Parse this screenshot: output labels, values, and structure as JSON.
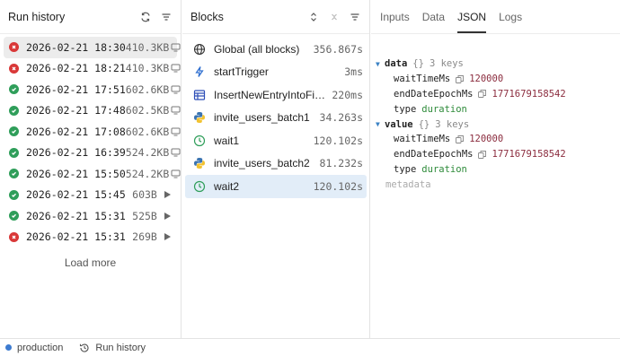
{
  "history": {
    "title": "Run history",
    "rows": [
      {
        "status": "error",
        "date": "2026-02-21 18:30",
        "size": "410.3KB",
        "action": "monitor-icon"
      },
      {
        "status": "error",
        "date": "2026-02-21 18:21",
        "size": "410.3KB",
        "action": "monitor-icon"
      },
      {
        "status": "success",
        "date": "2026-02-21 17:51",
        "size": "602.6KB",
        "action": "monitor-icon"
      },
      {
        "status": "success",
        "date": "2026-02-21 17:48",
        "size": "602.5KB",
        "action": "monitor-icon"
      },
      {
        "status": "success",
        "date": "2026-02-21 17:08",
        "size": "602.6KB",
        "action": "monitor-icon"
      },
      {
        "status": "success",
        "date": "2026-02-21 16:39",
        "size": "524.2KB",
        "action": "monitor-icon"
      },
      {
        "status": "success",
        "date": "2026-02-21 15:50",
        "size": "524.2KB",
        "action": "monitor-icon"
      },
      {
        "status": "success",
        "date": "2026-02-21 15:45",
        "size": "603B",
        "action": "play-icon"
      },
      {
        "status": "success",
        "date": "2026-02-21 15:31",
        "size": "525B",
        "action": "play-icon"
      },
      {
        "status": "error",
        "date": "2026-02-21 15:31",
        "size": "269B",
        "action": "play-icon"
      }
    ],
    "load_more": "Load more"
  },
  "blocks": {
    "title": "Blocks",
    "items": [
      {
        "icon": "globe-icon",
        "name": "Global (all blocks)",
        "time": "356.867s"
      },
      {
        "icon": "bolt-icon",
        "name": "startTrigger",
        "time": "3ms"
      },
      {
        "icon": "table-icon",
        "name": "InsertNewEntryIntoFiles...",
        "time": "220ms"
      },
      {
        "icon": "python-icon",
        "name": "invite_users_batch1",
        "time": "34.263s"
      },
      {
        "icon": "clock-icon",
        "name": "wait1",
        "time": "120.102s"
      },
      {
        "icon": "python-icon",
        "name": "invite_users_batch2",
        "time": "81.232s"
      },
      {
        "icon": "clock-icon",
        "name": "wait2",
        "time": "120.102s"
      }
    ]
  },
  "detail": {
    "tabs": [
      "Inputs",
      "Data",
      "JSON",
      "Logs"
    ],
    "active_tab": "JSON",
    "json": {
      "data_key": "data",
      "data_brace": "{}",
      "data_count": "3 keys",
      "data_fields": [
        {
          "key": "waitTimeMs",
          "value": "120000",
          "kind": "num"
        },
        {
          "key": "endDateEpochMs",
          "value": "1771679158542",
          "kind": "num"
        },
        {
          "key": "type",
          "value": "duration",
          "kind": "str"
        }
      ],
      "value_key": "value",
      "value_brace": "{}",
      "value_count": "3 keys",
      "value_fields": [
        {
          "key": "waitTimeMs",
          "value": "120000",
          "kind": "num"
        },
        {
          "key": "endDateEpochMs",
          "value": "1771679158542",
          "kind": "num"
        },
        {
          "key": "type",
          "value": "duration",
          "kind": "str"
        }
      ],
      "metadata_label": "metadata"
    }
  },
  "footer": {
    "environment": "production",
    "history_link": "Run history"
  },
  "colors": {
    "error": "#d93838",
    "success": "#2f9e5a",
    "selected_block": "#e2edf8",
    "accent": "#3b82c4"
  }
}
